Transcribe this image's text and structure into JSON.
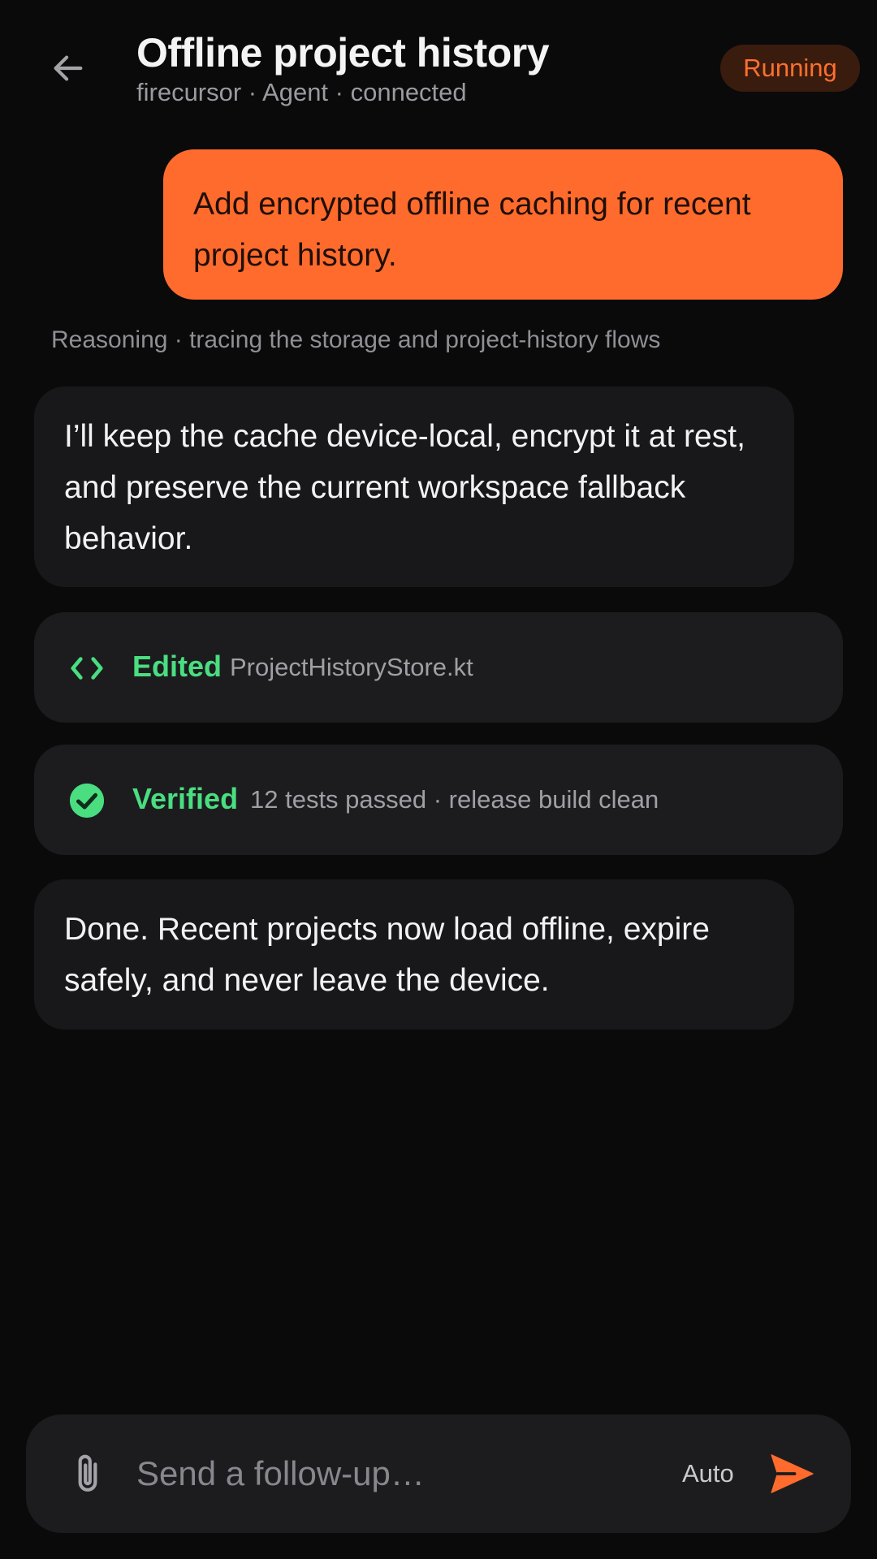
{
  "header": {
    "back_icon": "arrow-left-icon",
    "title": "Offline project history",
    "subtitle": "firecursor · Agent · connected",
    "status": "Running"
  },
  "conversation": {
    "user_message": "Add encrypted offline caching for recent project history.",
    "reasoning": "Reasoning · tracing the storage and project-history flows",
    "assistant_message_1": "I’ll keep the cache device-local, encrypt it at rest, and preserve the current workspace fallback behavior.",
    "edit_card": {
      "icon": "code-brackets-icon",
      "status": "Edited",
      "detail": "ProjectHistoryStore.kt"
    },
    "verify_card": {
      "icon": "check-circle-icon",
      "status": "Verified",
      "detail": "12 tests passed · release build clean"
    },
    "assistant_message_2": "Done. Recent projects now load offline, expire safely, and never leave the device."
  },
  "composer": {
    "attach_icon": "paperclip-icon",
    "placeholder": "Send a follow-up…",
    "value": "",
    "mode": "Auto",
    "send_icon": "send-icon"
  },
  "colors": {
    "background": "#0a0a0a",
    "accent": "#ff6b2d",
    "success": "#4ade80",
    "surface": "#18181b"
  }
}
